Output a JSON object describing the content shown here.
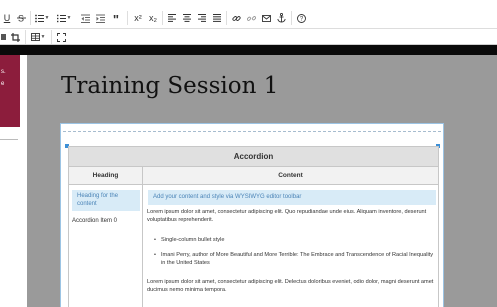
{
  "toolbar": {
    "row1": [
      "underline-icon",
      "strikethrough-icon",
      "bulleted-list-icon",
      "numbered-list-icon",
      "outdent-icon",
      "indent-icon",
      "blockquote-icon",
      "superscript-icon",
      "subscript-icon",
      "align-left-icon",
      "align-center-icon",
      "align-right-icon",
      "align-justify-icon",
      "link-icon",
      "unlink-icon",
      "email-icon",
      "anchor-icon",
      "help-icon"
    ],
    "row2": [
      "table-icon",
      "fullscreen-icon"
    ],
    "underline_glyph": "U",
    "superscript_glyph": "x²",
    "subscript_glyph": "x₂"
  },
  "sidebar": {
    "text_fragments": [
      "s.",
      "e"
    ],
    "accent_color": "#8c1d3c"
  },
  "page": {
    "title": "Training Session 1"
  },
  "accordion": {
    "header": "Accordion",
    "columns": [
      "Heading",
      "Content"
    ],
    "heading_placeholder": "Heading for the content",
    "item_label": "Accordion Item 0",
    "content_placeholder": "Add your content and style via WYSIWYG editor toolbar",
    "paragraph1": "Lorem ipsum dolor sit amet, consectetur adipiscing elit. Quo repudiandae unde eius. Aliquam inventore, deserunt voluptatibus reprehenderit.",
    "bullets": [
      "Single-column bullet style",
      "Imani Perry, author of More Beautiful and More Terrible: The Embrace and Transcendence of Racial Inequality in the United States"
    ],
    "paragraph2": "Lorem ipsum dolor sit amet, consectetur adipiscing elit. Delectus doloribus eveniet, odio dolor, magni deserunt amet ducimus nemo minima tempora."
  },
  "colors": {
    "selection_blue": "#3d8fd6",
    "highlight_bg": "#d8ebf7",
    "highlight_text": "#4b84b7"
  }
}
